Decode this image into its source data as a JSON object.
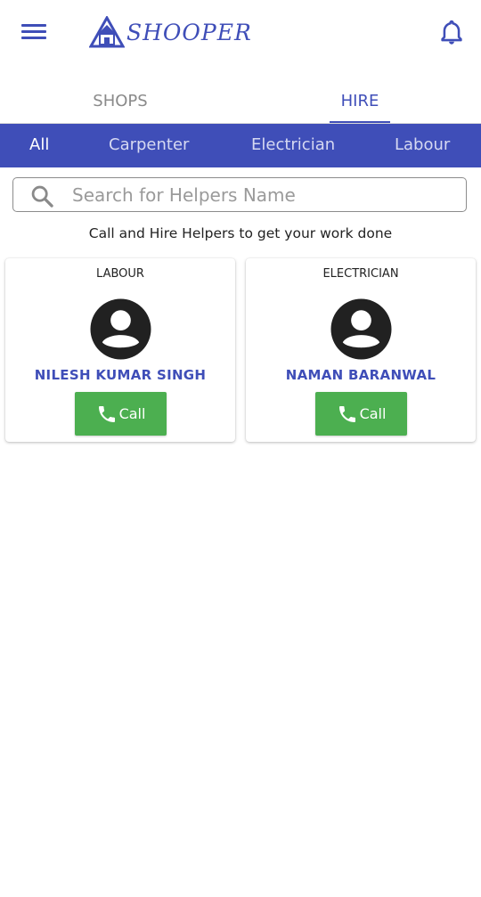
{
  "header": {
    "app_name": "SHOOPER",
    "menu_icon": "hamburger-menu-icon",
    "notification_icon": "bell-icon",
    "brand_color": "#3f4eb8"
  },
  "main_tabs": [
    {
      "label": "SHOPS",
      "selected": false
    },
    {
      "label": "HIRE",
      "selected": true
    }
  ],
  "categories": [
    {
      "label": "All",
      "selected": true
    },
    {
      "label": "Carpenter",
      "selected": false
    },
    {
      "label": "Electrician",
      "selected": false
    },
    {
      "label": "Labour",
      "selected": false
    }
  ],
  "search": {
    "placeholder": "Search for Helpers Name",
    "value": "",
    "icon": "search-icon"
  },
  "tagline": "Call and Hire Helpers to get your work done",
  "helpers": [
    {
      "category": "LABOUR",
      "name": "NILESH KUMAR SINGH",
      "call_label": "Call",
      "avatar_icon": "person-icon"
    },
    {
      "category": "ELECTRICIAN",
      "name": "NAMAN BARANWAL",
      "call_label": "Call",
      "avatar_icon": "person-icon"
    }
  ],
  "colors": {
    "category_bar": "#3f4eb8",
    "call_button": "#4caf50"
  }
}
